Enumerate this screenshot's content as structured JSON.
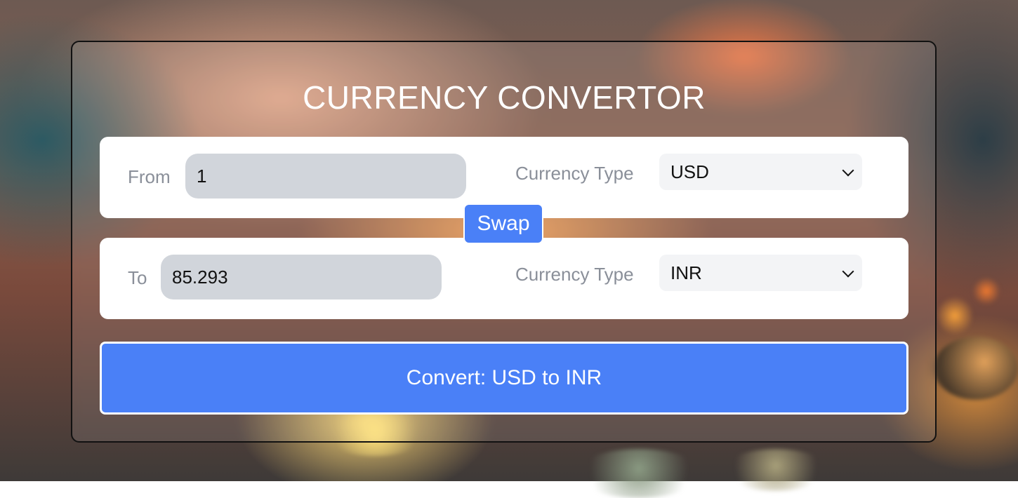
{
  "app": {
    "title": "CURRENCY CONVERTOR"
  },
  "from": {
    "label": "From",
    "amount": "1",
    "currency_label": "Currency Type",
    "currency": "USD"
  },
  "to": {
    "label": "To",
    "amount": "85.293",
    "currency_label": "Currency Type",
    "currency": "INR"
  },
  "swap": {
    "label": "Swap"
  },
  "convert": {
    "label": "Convert: USD to INR"
  },
  "colors": {
    "accent": "#4a80f7",
    "input_bg": "#d1d5db",
    "select_bg": "#f3f4f6",
    "label_text": "#8a8f99"
  },
  "icons": {
    "select_chevron": "chevron-down-icon"
  }
}
